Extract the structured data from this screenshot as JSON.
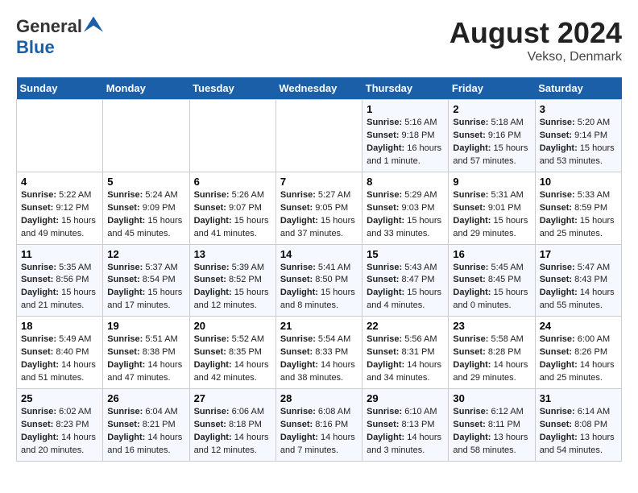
{
  "header": {
    "logo_general": "General",
    "logo_blue": "Blue",
    "title": "August 2024",
    "subtitle": "Vekso, Denmark"
  },
  "days_of_week": [
    "Sunday",
    "Monday",
    "Tuesday",
    "Wednesday",
    "Thursday",
    "Friday",
    "Saturday"
  ],
  "weeks": [
    [
      {
        "day": "",
        "info": ""
      },
      {
        "day": "",
        "info": ""
      },
      {
        "day": "",
        "info": ""
      },
      {
        "day": "",
        "info": ""
      },
      {
        "day": "1",
        "info": "Sunrise: 5:16 AM\nSunset: 9:18 PM\nDaylight: 16 hours and 1 minute."
      },
      {
        "day": "2",
        "info": "Sunrise: 5:18 AM\nSunset: 9:16 PM\nDaylight: 15 hours and 57 minutes."
      },
      {
        "day": "3",
        "info": "Sunrise: 5:20 AM\nSunset: 9:14 PM\nDaylight: 15 hours and 53 minutes."
      }
    ],
    [
      {
        "day": "4",
        "info": "Sunrise: 5:22 AM\nSunset: 9:12 PM\nDaylight: 15 hours and 49 minutes."
      },
      {
        "day": "5",
        "info": "Sunrise: 5:24 AM\nSunset: 9:09 PM\nDaylight: 15 hours and 45 minutes."
      },
      {
        "day": "6",
        "info": "Sunrise: 5:26 AM\nSunset: 9:07 PM\nDaylight: 15 hours and 41 minutes."
      },
      {
        "day": "7",
        "info": "Sunrise: 5:27 AM\nSunset: 9:05 PM\nDaylight: 15 hours and 37 minutes."
      },
      {
        "day": "8",
        "info": "Sunrise: 5:29 AM\nSunset: 9:03 PM\nDaylight: 15 hours and 33 minutes."
      },
      {
        "day": "9",
        "info": "Sunrise: 5:31 AM\nSunset: 9:01 PM\nDaylight: 15 hours and 29 minutes."
      },
      {
        "day": "10",
        "info": "Sunrise: 5:33 AM\nSunset: 8:59 PM\nDaylight: 15 hours and 25 minutes."
      }
    ],
    [
      {
        "day": "11",
        "info": "Sunrise: 5:35 AM\nSunset: 8:56 PM\nDaylight: 15 hours and 21 minutes."
      },
      {
        "day": "12",
        "info": "Sunrise: 5:37 AM\nSunset: 8:54 PM\nDaylight: 15 hours and 17 minutes."
      },
      {
        "day": "13",
        "info": "Sunrise: 5:39 AM\nSunset: 8:52 PM\nDaylight: 15 hours and 12 minutes."
      },
      {
        "day": "14",
        "info": "Sunrise: 5:41 AM\nSunset: 8:50 PM\nDaylight: 15 hours and 8 minutes."
      },
      {
        "day": "15",
        "info": "Sunrise: 5:43 AM\nSunset: 8:47 PM\nDaylight: 15 hours and 4 minutes."
      },
      {
        "day": "16",
        "info": "Sunrise: 5:45 AM\nSunset: 8:45 PM\nDaylight: 15 hours and 0 minutes."
      },
      {
        "day": "17",
        "info": "Sunrise: 5:47 AM\nSunset: 8:43 PM\nDaylight: 14 hours and 55 minutes."
      }
    ],
    [
      {
        "day": "18",
        "info": "Sunrise: 5:49 AM\nSunset: 8:40 PM\nDaylight: 14 hours and 51 minutes."
      },
      {
        "day": "19",
        "info": "Sunrise: 5:51 AM\nSunset: 8:38 PM\nDaylight: 14 hours and 47 minutes."
      },
      {
        "day": "20",
        "info": "Sunrise: 5:52 AM\nSunset: 8:35 PM\nDaylight: 14 hours and 42 minutes."
      },
      {
        "day": "21",
        "info": "Sunrise: 5:54 AM\nSunset: 8:33 PM\nDaylight: 14 hours and 38 minutes."
      },
      {
        "day": "22",
        "info": "Sunrise: 5:56 AM\nSunset: 8:31 PM\nDaylight: 14 hours and 34 minutes."
      },
      {
        "day": "23",
        "info": "Sunrise: 5:58 AM\nSunset: 8:28 PM\nDaylight: 14 hours and 29 minutes."
      },
      {
        "day": "24",
        "info": "Sunrise: 6:00 AM\nSunset: 8:26 PM\nDaylight: 14 hours and 25 minutes."
      }
    ],
    [
      {
        "day": "25",
        "info": "Sunrise: 6:02 AM\nSunset: 8:23 PM\nDaylight: 14 hours and 20 minutes."
      },
      {
        "day": "26",
        "info": "Sunrise: 6:04 AM\nSunset: 8:21 PM\nDaylight: 14 hours and 16 minutes."
      },
      {
        "day": "27",
        "info": "Sunrise: 6:06 AM\nSunset: 8:18 PM\nDaylight: 14 hours and 12 minutes."
      },
      {
        "day": "28",
        "info": "Sunrise: 6:08 AM\nSunset: 8:16 PM\nDaylight: 14 hours and 7 minutes."
      },
      {
        "day": "29",
        "info": "Sunrise: 6:10 AM\nSunset: 8:13 PM\nDaylight: 14 hours and 3 minutes."
      },
      {
        "day": "30",
        "info": "Sunrise: 6:12 AM\nSunset: 8:11 PM\nDaylight: 13 hours and 58 minutes."
      },
      {
        "day": "31",
        "info": "Sunrise: 6:14 AM\nSunset: 8:08 PM\nDaylight: 13 hours and 54 minutes."
      }
    ]
  ]
}
